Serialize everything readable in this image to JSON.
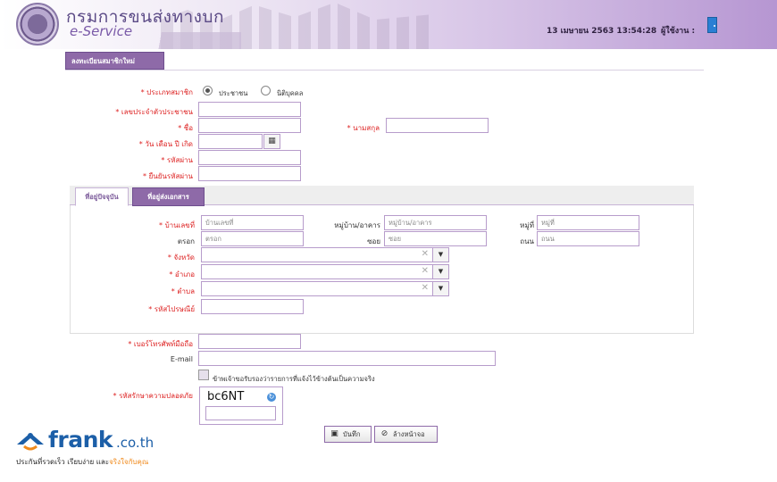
{
  "header": {
    "brand_thai": "กรมการขนส่งทางบก",
    "brand_en": "e-Service",
    "datetime": "13 เมษายน 2563 13:54:28",
    "user_label": "ผู้ใช้งาน :"
  },
  "page_title": "ลงทะเบียนสมาชิกใหม่",
  "form": {
    "member_type": {
      "label": "ประเภทสมาชิก",
      "options": [
        "ประชาชน",
        "นิติบุคคล"
      ],
      "selected": "ประชาชน"
    },
    "citizen_id": {
      "label": "เลขประจำตัวประชาชน",
      "value": ""
    },
    "first_name": {
      "label": "ชื่อ",
      "value": ""
    },
    "last_name": {
      "label": "นามสกุล",
      "value": ""
    },
    "birthdate": {
      "label": "วัน เดือน ปี เกิด",
      "value": ""
    },
    "password": {
      "label": "รหัสผ่าน",
      "value": ""
    },
    "password_confirm": {
      "label": "ยืนยันรหัสผ่าน",
      "value": ""
    },
    "required_mark": "*"
  },
  "address": {
    "tabs": [
      "ที่อยู่ปัจจุบัน",
      "ที่อยู่ส่งเอกสาร"
    ],
    "active_tab": "ที่อยู่ปัจจุบัน",
    "house_no": {
      "label": "บ้านเลขที่",
      "placeholder": "บ้านเลขที่"
    },
    "village": {
      "label": "หมู่บ้าน/อาคาร",
      "placeholder": "หมู่บ้าน/อาคาร"
    },
    "moo": {
      "label": "หมู่ที่",
      "placeholder": "หมู่ที่"
    },
    "trok": {
      "label": "ตรอก",
      "placeholder": "ตรอก"
    },
    "soi": {
      "label": "ซอย",
      "placeholder": "ซอย"
    },
    "road": {
      "label": "ถนน",
      "placeholder": "ถนน"
    },
    "province": {
      "label": "จังหวัด",
      "value": ""
    },
    "district": {
      "label": "อำเภอ",
      "value": ""
    },
    "subdistrict": {
      "label": "ตำบล",
      "value": ""
    },
    "postcode": {
      "label": "รหัสไปรษณีย์",
      "value": ""
    }
  },
  "contact": {
    "mobile": {
      "label": "เบอร์โทรศัพท์มือถือ",
      "value": ""
    },
    "email": {
      "label": "E-mail",
      "value": ""
    }
  },
  "consent_text": "ข้าพเจ้าขอรับรองว่ารายการที่แจ้งไว้ข้างต้นเป็นความจริง",
  "captcha": {
    "label": "รหัสรักษาความปลอดภัย",
    "code": "bc6NT",
    "value": ""
  },
  "buttons": {
    "save": "บันทึก",
    "clear": "ล้างหน้าจอ"
  },
  "watermark": {
    "brand": "frank",
    "tld": ".co.th",
    "tagline_main": "ประกันที่รวดเร็ว เรียบง่าย และ",
    "tagline_accent": "จริงใจกับคุณ"
  },
  "colors": {
    "accent": "#8e6aa8",
    "required": "#d22222",
    "brand_blue": "#1c5fa8",
    "brand_orange": "#f08a1c"
  }
}
